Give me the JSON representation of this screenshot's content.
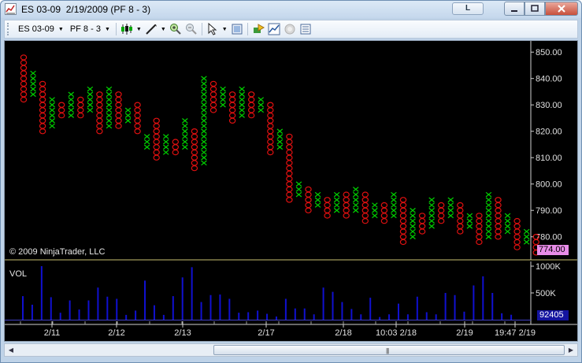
{
  "window": {
    "title": "ES 03-09  2/19/2009 (PF 8 - 3)",
    "link_button": "L",
    "minimize_icon": "minimize-icon",
    "maximize_icon": "maximize-icon",
    "close_icon": "close-icon"
  },
  "toolbar": {
    "instrument": "ES 03-09",
    "period": "PF 8 - 3",
    "icons": [
      "candlestick-style-icon",
      "drawing-tools-icon",
      "zoom-in-icon",
      "zoom-out-icon",
      "pointer-icon",
      "data-box-icon",
      "strategies-icon",
      "indicators-icon",
      "disabled-icon",
      "properties-icon"
    ]
  },
  "chart": {
    "copyright": "© 2009 NinjaTrader, LLC",
    "volume_label": "VOL",
    "last_price": "774.00",
    "last_volume": "92405",
    "colors": {
      "x_column": "#00d000",
      "o_column": "#e01010",
      "volume_bar": "#1010d0",
      "axis_text": "#e0e0e0",
      "separator": "#c8c070"
    }
  },
  "chart_data": {
    "type": "point-and-figure",
    "box_size": 2,
    "reversal": 3,
    "price_axis": {
      "ticks": [
        "850.00",
        "840.00",
        "830.00",
        "820.00",
        "810.00",
        "800.00",
        "790.00",
        "780.00"
      ],
      "range": [
        772,
        852
      ]
    },
    "volume_axis": {
      "ticks": [
        "1000K",
        "500K"
      ],
      "range": [
        0,
        1000000
      ]
    },
    "time_labels": [
      "2/11",
      "2/12",
      "2/13",
      "2/17",
      "2/18",
      "10:03 2/18",
      "2/19",
      "19:47 2/19"
    ],
    "columns": [
      {
        "type": "O",
        "high": 848,
        "low": 832
      },
      {
        "type": "X",
        "high": 842,
        "low": 834
      },
      {
        "type": "O",
        "high": 838,
        "low": 820
      },
      {
        "type": "X",
        "high": 832,
        "low": 822
      },
      {
        "type": "O",
        "high": 830,
        "low": 826
      },
      {
        "type": "X",
        "high": 834,
        "low": 826
      },
      {
        "type": "O",
        "high": 832,
        "low": 826
      },
      {
        "type": "X",
        "high": 836,
        "low": 828
      },
      {
        "type": "O",
        "high": 834,
        "low": 820
      },
      {
        "type": "X",
        "high": 836,
        "low": 822
      },
      {
        "type": "O",
        "high": 834,
        "low": 822
      },
      {
        "type": "X",
        "high": 828,
        "low": 824
      },
      {
        "type": "O",
        "high": 830,
        "low": 820
      },
      {
        "type": "X",
        "high": 818,
        "low": 814
      },
      {
        "type": "O",
        "high": 824,
        "low": 810
      },
      {
        "type": "X",
        "high": 818,
        "low": 812
      },
      {
        "type": "O",
        "high": 816,
        "low": 812
      },
      {
        "type": "X",
        "high": 824,
        "low": 814
      },
      {
        "type": "O",
        "high": 820,
        "low": 806
      },
      {
        "type": "X",
        "high": 840,
        "low": 808
      },
      {
        "type": "O",
        "high": 838,
        "low": 828
      },
      {
        "type": "X",
        "high": 836,
        "low": 830
      },
      {
        "type": "O",
        "high": 834,
        "low": 824
      },
      {
        "type": "X",
        "high": 836,
        "low": 826
      },
      {
        "type": "O",
        "high": 834,
        "low": 826
      },
      {
        "type": "X",
        "high": 832,
        "low": 828
      },
      {
        "type": "O",
        "high": 830,
        "low": 812
      },
      {
        "type": "X",
        "high": 820,
        "low": 814
      },
      {
        "type": "O",
        "high": 818,
        "low": 794
      },
      {
        "type": "X",
        "high": 800,
        "low": 796
      },
      {
        "type": "O",
        "high": 798,
        "low": 790
      },
      {
        "type": "X",
        "high": 796,
        "low": 792
      },
      {
        "type": "O",
        "high": 794,
        "low": 788
      },
      {
        "type": "X",
        "high": 796,
        "low": 790
      },
      {
        "type": "O",
        "high": 796,
        "low": 788
      },
      {
        "type": "X",
        "high": 798,
        "low": 790
      },
      {
        "type": "O",
        "high": 796,
        "low": 786
      },
      {
        "type": "X",
        "high": 792,
        "low": 788
      },
      {
        "type": "O",
        "high": 792,
        "low": 786
      },
      {
        "type": "X",
        "high": 796,
        "low": 788
      },
      {
        "type": "O",
        "high": 794,
        "low": 778
      },
      {
        "type": "X",
        "high": 790,
        "low": 780
      },
      {
        "type": "O",
        "high": 788,
        "low": 782
      },
      {
        "type": "X",
        "high": 794,
        "low": 784
      },
      {
        "type": "O",
        "high": 792,
        "low": 786
      },
      {
        "type": "X",
        "high": 794,
        "low": 788
      },
      {
        "type": "O",
        "high": 792,
        "low": 782
      },
      {
        "type": "X",
        "high": 788,
        "low": 784
      },
      {
        "type": "O",
        "high": 788,
        "low": 778
      },
      {
        "type": "X",
        "high": 796,
        "low": 780
      },
      {
        "type": "O",
        "high": 794,
        "low": 780
      },
      {
        "type": "X",
        "high": 788,
        "low": 782
      },
      {
        "type": "O",
        "high": 786,
        "low": 776
      },
      {
        "type": "X",
        "high": 782,
        "low": 778
      },
      {
        "type": "O",
        "high": 780,
        "low": 774
      }
    ],
    "volume": [
      {
        "label": "2/11",
        "bars": [
          440000,
          280000,
          1000000,
          420000,
          130000,
          360000,
          190000,
          360000,
          600000,
          430000,
          390000,
          90000,
          170000,
          730000,
          270000,
          90000
        ]
      },
      {
        "label": "2/13",
        "bars": [
          440000,
          790000,
          980000,
          330000,
          460000,
          470000,
          390000,
          130000,
          140000,
          170000,
          110000,
          60000,
          390000,
          210000,
          210000,
          100000
        ]
      },
      {
        "label": "2/18",
        "bars": [
          600000,
          520000,
          330000,
          200000,
          100000,
          410000,
          50000,
          100000,
          300000,
          100000,
          430000,
          140000,
          100000,
          500000,
          460000,
          150000,
          640000,
          810000,
          500000,
          120000,
          92405
        ]
      }
    ]
  }
}
